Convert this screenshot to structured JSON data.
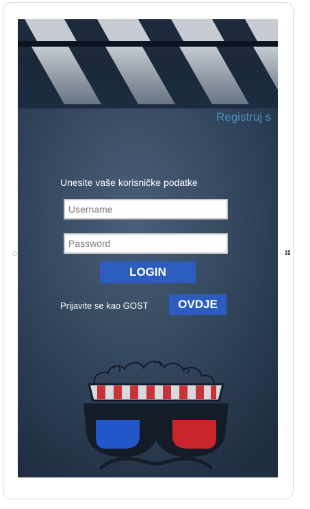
{
  "header": {
    "register_link": "Registruj s"
  },
  "login_form": {
    "title": "Unesite vaše korisničke podatke",
    "username_placeholder": "Username",
    "password_placeholder": "Password",
    "login_button": "LOGIN"
  },
  "guest": {
    "text": "Prijavite se kao GOST",
    "button": "OVDJE"
  },
  "colors": {
    "accent_button": "#2d5cbf",
    "register_link": "#4d8fbf",
    "background": "#2b3d52"
  },
  "icons": [
    "clapperboard-icon",
    "popcorn-3d-glasses-logo",
    "windows-icon",
    "home-button-icon"
  ]
}
